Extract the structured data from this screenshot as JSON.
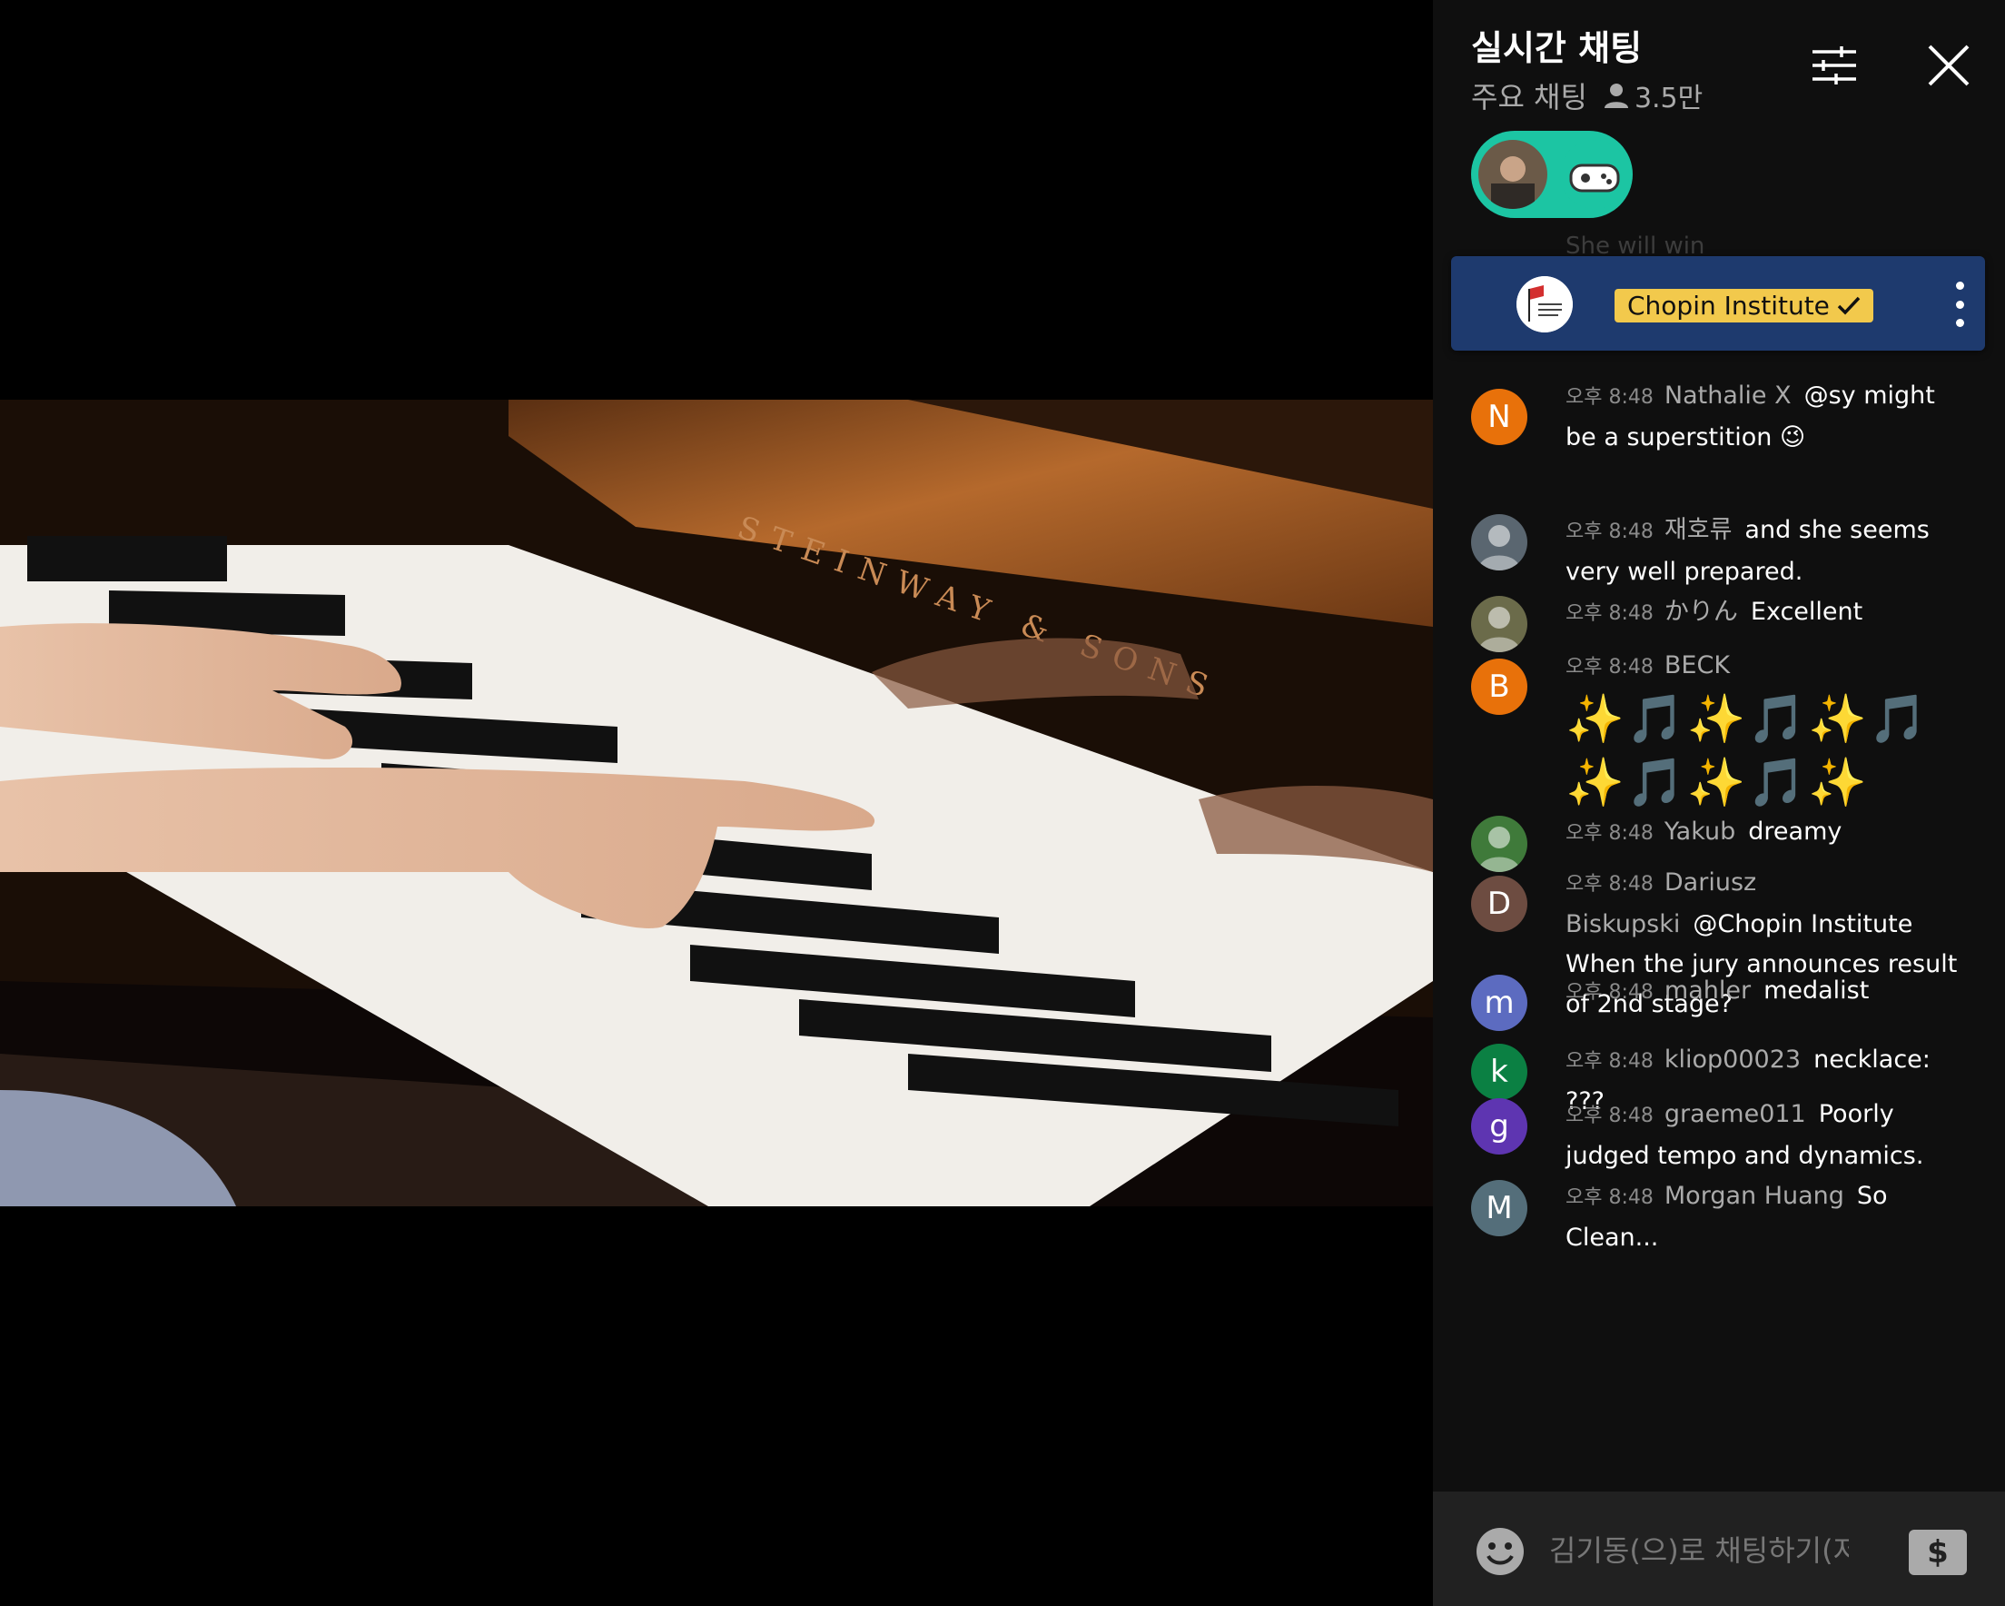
{
  "chat": {
    "title": "실시간 채팅",
    "mode": "주요 채팅",
    "viewers": "3.5만",
    "icons": {
      "filter": "filter-sliders-icon",
      "close": "close-icon",
      "viewers": "person-icon"
    }
  },
  "pinned": {
    "ghost_text": "She will win",
    "channel_name": "Chopin Institute",
    "verified": true,
    "menu_icon": "more-vertical-icon"
  },
  "messages": [
    {
      "time": "오후 8:48",
      "author": "Nathalie X",
      "text": "@sy might be a superstition 😉",
      "avatar_letter": "N",
      "avatar_color": "#e8710a"
    },
    {
      "time": "오후 8:48",
      "author": "재호류",
      "text": "and she seems very well prepared.",
      "avatar_letter": "",
      "avatar_color": "#5a6670"
    },
    {
      "time": "오후 8:48",
      "author": "かりん",
      "text": "Excellent",
      "avatar_letter": "",
      "avatar_color": "#6b6b4a"
    },
    {
      "time": "오후 8:48",
      "author": "BECK",
      "text": "✨🎵✨🎵✨🎵 ✨🎵✨🎵✨",
      "avatar_letter": "B",
      "avatar_color": "#e8710a"
    },
    {
      "time": "오후 8:48",
      "author": "Yakub",
      "text": "dreamy",
      "avatar_letter": "",
      "avatar_color": "#3f7a3a"
    },
    {
      "time": "오후 8:48",
      "author": "Dariusz Biskupski",
      "text": "@Chopin Institute When the jury announces result of 2nd stage?",
      "avatar_letter": "D",
      "avatar_color": "#6d4c41"
    },
    {
      "time": "오후 8:48",
      "author": "mahler",
      "text": "medalist",
      "avatar_letter": "m",
      "avatar_color": "#5c6bc0"
    },
    {
      "time": "오후 8:48",
      "author": "kliop00023",
      "text": "necklace: ???",
      "avatar_letter": "k",
      "avatar_color": "#0b8043"
    },
    {
      "time": "오후 8:48",
      "author": "graeme011",
      "text": "Poorly judged tempo and dynamics.",
      "avatar_letter": "g",
      "avatar_color": "#5e35b1"
    },
    {
      "time": "오후 8:48",
      "author": "Morgan Huang",
      "text": "So Clean...",
      "avatar_letter": "M",
      "avatar_color": "#546e7a"
    }
  ],
  "composer": {
    "placeholder": "김기동(으)로 채팅하기(저...",
    "superchat_symbol": "$",
    "icons": {
      "emoji": "smiley-face-icon",
      "superchat": "superchat-dollar-icon"
    }
  },
  "video": {
    "piano_brand": "STEINWAY & SONS"
  }
}
